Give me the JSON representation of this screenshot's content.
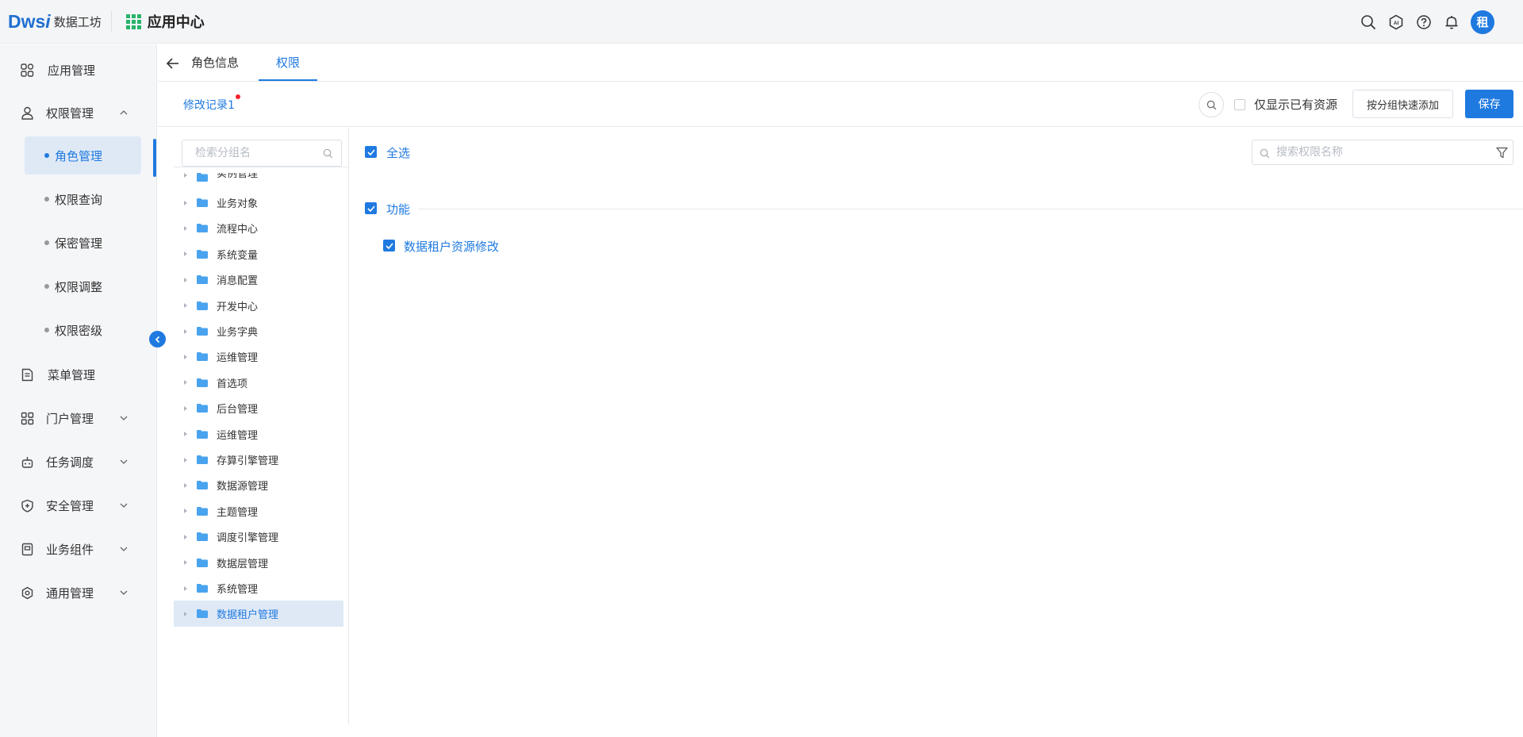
{
  "header": {
    "logo_mark": "Dws",
    "logo_mark_i": "i",
    "logo_text": "数据工坊",
    "app_center": "应用中心",
    "avatar_text": "租",
    "icons": [
      "search-icon",
      "ai-icon",
      "help-icon",
      "bell-icon"
    ]
  },
  "sidebar": {
    "items": [
      {
        "label": "应用管理",
        "icon": "apps-icon"
      },
      {
        "label": "权限管理",
        "icon": "user-lock-icon",
        "expanded": true
      },
      {
        "label": "菜单管理",
        "icon": "menu-doc-icon"
      },
      {
        "label": "门户管理",
        "icon": "portal-icon"
      },
      {
        "label": "任务调度",
        "icon": "robot-icon"
      },
      {
        "label": "安全管理",
        "icon": "shield-icon"
      },
      {
        "label": "业务组件",
        "icon": "component-icon"
      },
      {
        "label": "通用管理",
        "icon": "settings-icon"
      }
    ],
    "sub_items": [
      {
        "label": "角色管理",
        "active": true
      },
      {
        "label": "权限查询"
      },
      {
        "label": "保密管理"
      },
      {
        "label": "权限调整"
      },
      {
        "label": "权限密级"
      }
    ]
  },
  "tabs": [
    {
      "label": "角色信息"
    },
    {
      "label": "权限",
      "active": true
    }
  ],
  "toolbar": {
    "modify_log": "修改记录1",
    "only_show_existing": "仅显示已有资源",
    "quick_add": "按分组快速添加",
    "save": "保存"
  },
  "group_panel": {
    "search_placeholder": "检索分组名",
    "groups": [
      {
        "label": "实例管理"
      },
      {
        "label": "业务对象"
      },
      {
        "label": "流程中心"
      },
      {
        "label": "系统变量"
      },
      {
        "label": "消息配置"
      },
      {
        "label": "开发中心"
      },
      {
        "label": "业务字典"
      },
      {
        "label": "运维管理"
      },
      {
        "label": "首选项"
      },
      {
        "label": "后台管理"
      },
      {
        "label": "运维管理"
      },
      {
        "label": "存算引擎管理"
      },
      {
        "label": "数据源管理"
      },
      {
        "label": "主题管理"
      },
      {
        "label": "调度引擎管理"
      },
      {
        "label": "数据层管理"
      },
      {
        "label": "系统管理"
      },
      {
        "label": "数据租户管理",
        "selected": true
      }
    ]
  },
  "perm_panel": {
    "select_all": "全选",
    "search_placeholder": "搜索权限名称",
    "section": "功能",
    "items": [
      {
        "label": "数据租户资源修改",
        "checked": true
      }
    ]
  },
  "colors": {
    "accent": "#1f7ae0",
    "active_bg": "#dfe9f6",
    "sidebar_bg": "#f5f6f8",
    "folder": "#4aa3ee",
    "badge_red": "#f5222d"
  }
}
